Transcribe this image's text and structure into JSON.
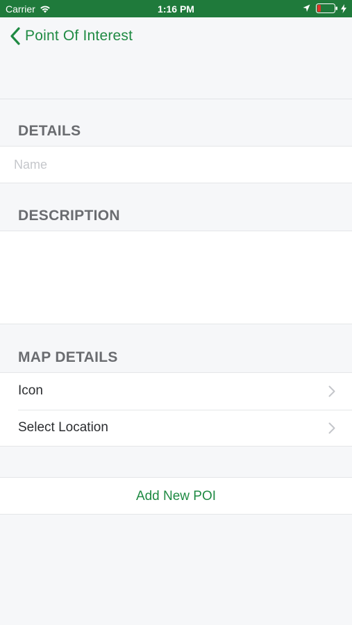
{
  "status_bar": {
    "carrier": "Carrier",
    "time": "1:16 PM",
    "background_color": "#1f7a3b",
    "icons": [
      "wifi-icon",
      "location-arrow-icon",
      "battery-low-icon",
      "charging-bolt-icon"
    ]
  },
  "nav": {
    "back_label": "Point Of Interest",
    "back_icon": "chevron-left-icon",
    "accent_color": "#1f8a43"
  },
  "sections": {
    "details": {
      "header": "DETAILS",
      "name_placeholder": "Name",
      "name_value": ""
    },
    "description": {
      "header": "DESCRIPTION",
      "value": ""
    },
    "map_details": {
      "header": "MAP DETAILS",
      "rows": [
        {
          "label": "Icon",
          "icon": "chevron-right-icon"
        },
        {
          "label": "Select Location",
          "icon": "chevron-right-icon"
        }
      ]
    }
  },
  "actions": {
    "add_label": "Add New POI"
  }
}
